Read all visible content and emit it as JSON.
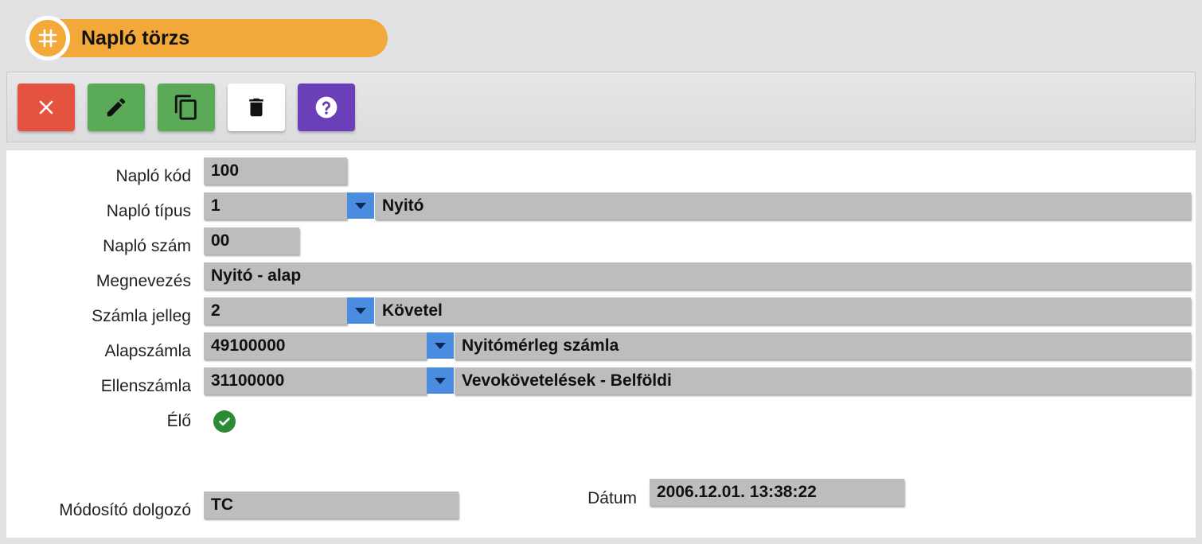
{
  "header": {
    "title": "Napló törzs",
    "icon": "hash-icon",
    "accent": "#f2a93a"
  },
  "toolbar": {
    "buttons": [
      {
        "name": "close",
        "icon": "close-icon",
        "color": "#e4533f"
      },
      {
        "name": "edit",
        "icon": "pencil-icon",
        "color": "#5aaa57"
      },
      {
        "name": "copy",
        "icon": "copy-icon",
        "color": "#5aaa57"
      },
      {
        "name": "delete",
        "icon": "trash-icon",
        "color": "#ffffff"
      },
      {
        "name": "help",
        "icon": "help-icon",
        "color": "#6a3fb8"
      }
    ]
  },
  "form": {
    "naplo_kod": {
      "label": "Napló kód",
      "value": "100"
    },
    "naplo_tipus": {
      "label": "Napló típus",
      "code": "1",
      "text": "Nyitó"
    },
    "naplo_szam": {
      "label": "Napló szám",
      "value": "00"
    },
    "megnevezes": {
      "label": "Megnevezés",
      "value": "Nyitó - alap"
    },
    "szamla_jelleg": {
      "label": "Számla jelleg",
      "code": "2",
      "text": "Követel"
    },
    "alapszamla": {
      "label": "Alapszámla",
      "code": "49100000",
      "text": "Nyitómérleg számla"
    },
    "ellenszamla": {
      "label": "Ellenszámla",
      "code": "31100000",
      "text": "Vevokövetelések - Belföldi"
    },
    "elo": {
      "label": "Élő",
      "checked": true,
      "icon": "check-circle-icon",
      "color": "#2e8b35"
    },
    "modosito": {
      "label": "Módosító dolgozó",
      "value": "TC"
    },
    "datum": {
      "label": "Dátum",
      "value": "2006.12.01. 13:38:22"
    }
  }
}
